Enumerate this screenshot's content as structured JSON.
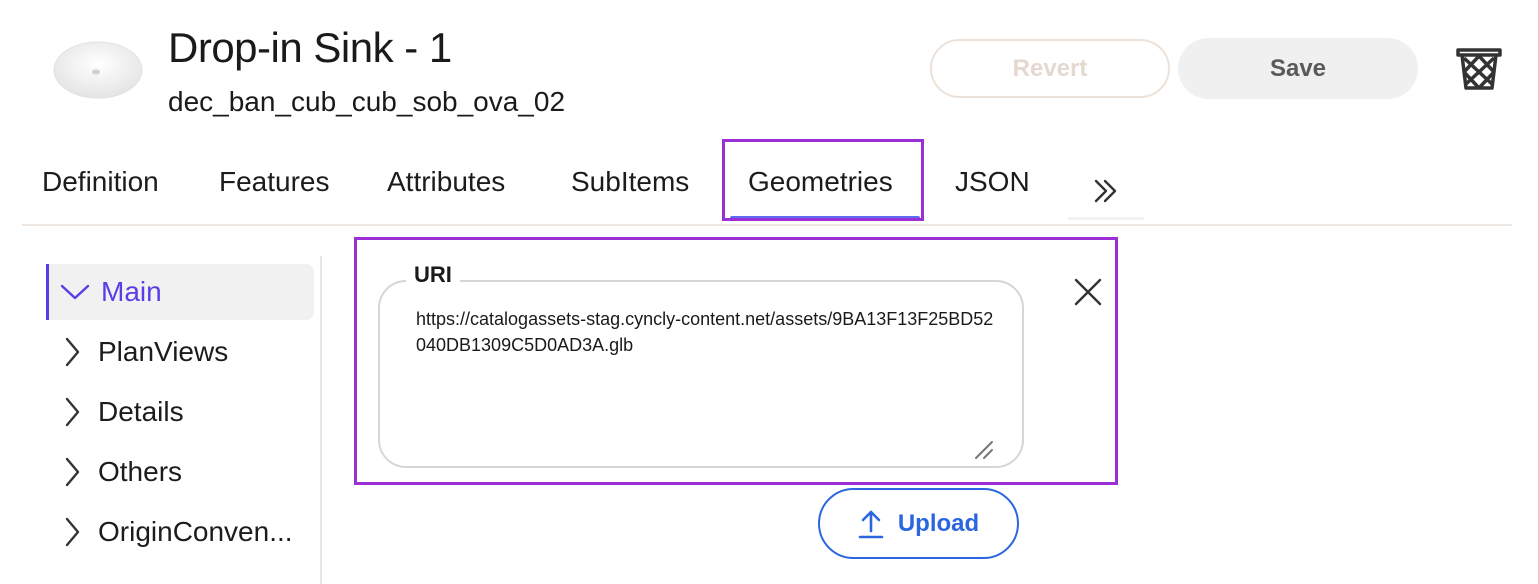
{
  "header": {
    "title": "Drop-in Sink - 1",
    "code": "dec_ban_cub_cub_sob_ova_02",
    "revert_label": "Revert",
    "save_label": "Save"
  },
  "tabs": [
    {
      "label": "Definition"
    },
    {
      "label": "Features"
    },
    {
      "label": "Attributes"
    },
    {
      "label": "SubItems"
    },
    {
      "label": "Geometries",
      "active": true
    },
    {
      "label": "JSON"
    }
  ],
  "tree": {
    "items": [
      {
        "label": "Main",
        "expanded": true
      },
      {
        "label": "PlanViews"
      },
      {
        "label": "Details"
      },
      {
        "label": "Others"
      },
      {
        "label": "OriginConven..."
      }
    ]
  },
  "geometry": {
    "uri_label": "URI",
    "uri_value": "https://catalogassets-stag.cyncly-content.net/assets/9BA13F13F25BD52040DB1309C5D0AD3A.glb",
    "upload_label": "Upload"
  },
  "colors": {
    "accent": "#5b3ce6",
    "tab_underline": "#5b6cf0",
    "highlight": "#9b2fd6",
    "upload_blue": "#2b66e0"
  }
}
